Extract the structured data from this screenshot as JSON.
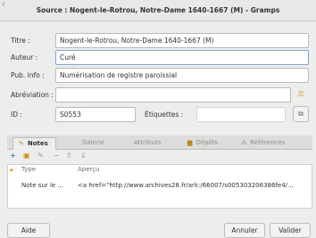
{
  "window": {
    "title": "Source : Nogent-le-Rotrou, Notre-Dame 1640-1667 (M) - Gramps",
    "corner_mark": "r"
  },
  "form": {
    "title_label": "Titre :",
    "title_value": "Nogent-le-Rotrou, Notre-Dame 1640-1667 (M)",
    "author_label": "Auteur :",
    "author_value": "Curé",
    "pubinfo_label": "Pub. info :",
    "pubinfo_value": "Numérisation de registre paroissial",
    "abbrev_label": "Abréviation :",
    "abbrev_value": "",
    "id_label": "ID :",
    "id_value": "S0553",
    "tags_label": "Étiquettes :"
  },
  "tabs": [
    {
      "label": "Notes",
      "icon": "notes-icon",
      "active": true
    },
    {
      "label": "Galerie",
      "icon": "",
      "active": false
    },
    {
      "label": "Attributs",
      "icon": "",
      "active": false
    },
    {
      "label": "Dépôts",
      "icon": "repository-icon",
      "active": false
    },
    {
      "label": "Références",
      "icon": "references-icon",
      "active": false
    }
  ],
  "notes_table": {
    "columns": [
      "Type",
      "Aperçu"
    ],
    "rows": [
      {
        "type": "Note sur le ...",
        "preview": "<a href=\"http://www.archives28.fr/ark:/66007/s005303206386fe4/..."
      }
    ]
  },
  "buttons": {
    "help": "Aide",
    "cancel": "Annuler",
    "ok": "Valider"
  },
  "colors": {
    "active_tab": "#2e3436",
    "inactive_tab": "#8e8e8c",
    "focus_border": "#7fa5d3"
  }
}
